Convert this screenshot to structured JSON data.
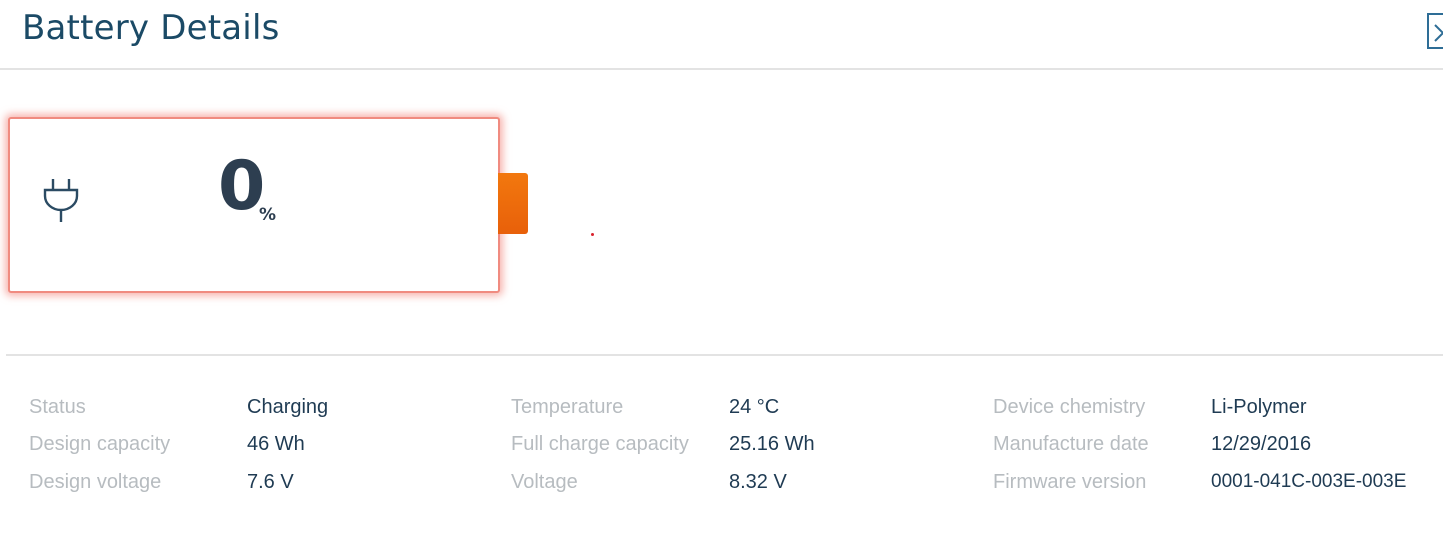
{
  "header": {
    "title": "Battery Details",
    "close_icon": "close-icon"
  },
  "battery": {
    "percent": "0",
    "percent_unit": "%",
    "charge_level": 0,
    "plug_icon": "plug-icon",
    "accent_color": "#ee6a0c",
    "outline_color": "#f08b80"
  },
  "details": {
    "status_label": "Status",
    "status_value": "Charging",
    "design_capacity_label": "Design capacity",
    "design_capacity_value": "46 Wh",
    "design_voltage_label": "Design voltage",
    "design_voltage_value": "7.6 V",
    "temperature_label": "Temperature",
    "temperature_value": "24 °C",
    "full_charge_capacity_label": "Full charge capacity",
    "full_charge_capacity_value": "25.16 Wh",
    "voltage_label": "Voltage",
    "voltage_value": "8.32 V",
    "device_chemistry_label": "Device chemistry",
    "device_chemistry_value": "Li-Polymer",
    "manufacture_date_label": "Manufacture date",
    "manufacture_date_value": "12/29/2016",
    "firmware_version_label": "Firmware version",
    "firmware_version_value": "0001-041C-003E-003E"
  }
}
